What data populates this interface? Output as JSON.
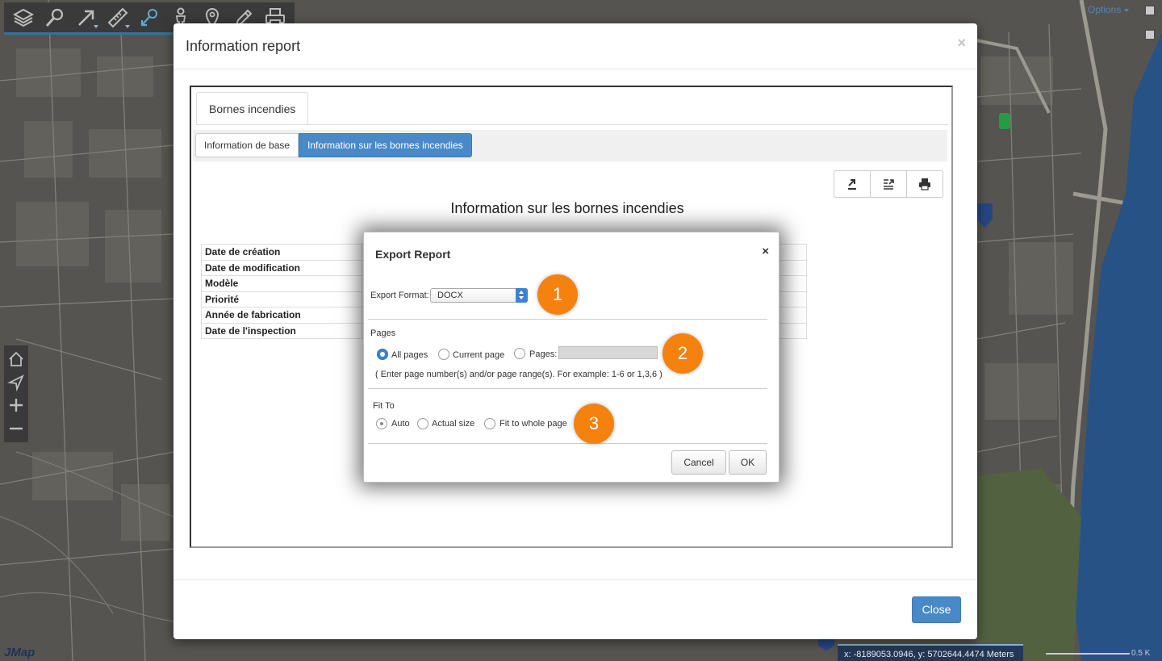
{
  "toolbar": {
    "tools": [
      {
        "name": "layers-icon"
      },
      {
        "name": "search-icon"
      },
      {
        "name": "select-arrow-icon"
      },
      {
        "name": "measure-ruler-icon"
      },
      {
        "name": "info-tool-icon"
      },
      {
        "name": "person-icon"
      },
      {
        "name": "location-pin-icon"
      },
      {
        "name": "edit-pencil-icon"
      },
      {
        "name": "print-icon"
      }
    ]
  },
  "options_label": "Options",
  "left_nav": [
    "home-icon",
    "navigate-icon",
    "zoom-in-icon",
    "zoom-out-icon"
  ],
  "logo_text": "JMap",
  "coords_text": "x: -8189053.0946, y: 5702644.4474 Meters",
  "scale_text": "0.5 K",
  "report_modal": {
    "title": "Information report",
    "close_symbol": "×",
    "outer_tab": "Bornes incendies",
    "sub_tabs": [
      "Information de base",
      "Information sur les bornes incendies"
    ],
    "report_heading": "Information sur les bornes incendies",
    "rows": [
      "Date de création",
      "Date de modification",
      "Modèle",
      "Priorité",
      "Année de fabrication",
      "Date de l'inspection"
    ],
    "close_button": "Close"
  },
  "export_dialog": {
    "title": "Export Report",
    "close_symbol": "×",
    "format_label": "Export Format:",
    "format_value": "DOCX",
    "pages_label": "Pages",
    "page_options": [
      "All pages",
      "Current page",
      "Pages:"
    ],
    "page_hint": "( Enter page number(s) and/or page range(s). For example: 1-6 or 1,3,6 )",
    "fit_label": "Fit To",
    "fit_options": [
      "Auto",
      "Actual size",
      "Fit to whole page"
    ],
    "cancel": "Cancel",
    "ok": "OK"
  },
  "badges": [
    "1",
    "2",
    "3"
  ],
  "colors": {
    "accent_blue": "#4a89c8",
    "badge_orange": "#f5820f",
    "toolbar": "#3f3f3f"
  }
}
